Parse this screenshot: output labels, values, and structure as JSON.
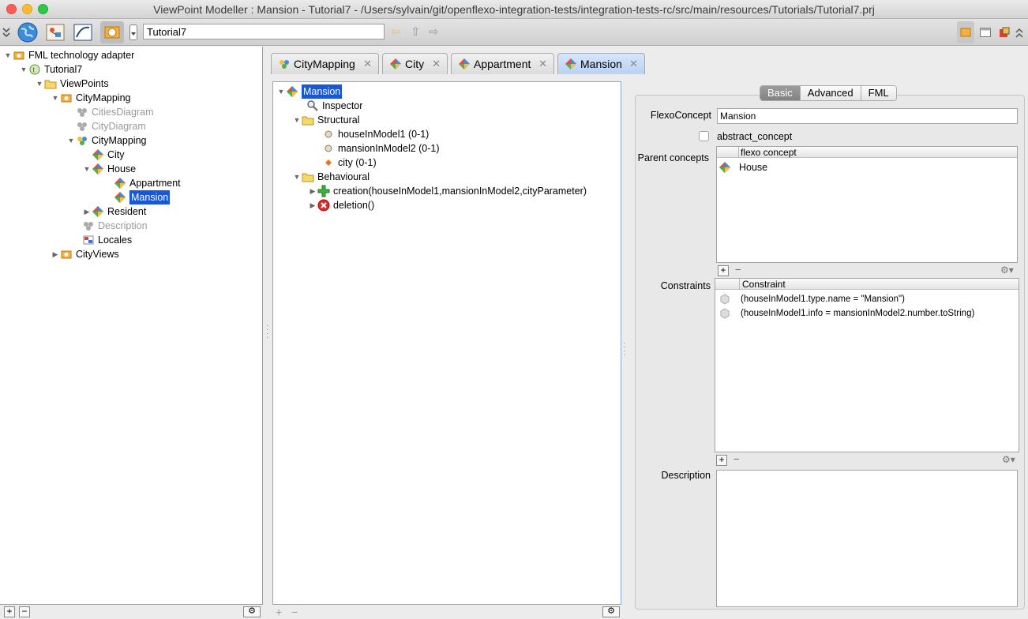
{
  "window": {
    "title": "ViewPoint Modeller : Mansion - Tutorial7 - /Users/sylvain/git/openflexo-integration-tests/integration-tests-rc/src/main/resources/Tutorials/Tutorial7.prj"
  },
  "toolbar": {
    "project_value": "Tutorial7",
    "icons": [
      "double-chevron-icon",
      "globe-icon",
      "diagram-icon",
      "draw-icon",
      "viewpoint-icon",
      "dropdown-icon",
      "back-arrow-icon",
      "up-arrow-icon",
      "forward-arrow-icon",
      "viewpoint-mode-icon",
      "panel-icon",
      "layout-icon",
      "collapse-icon"
    ]
  },
  "left_tree": {
    "items": [
      {
        "label": "FML technology adapter"
      },
      {
        "label": "Tutorial7"
      },
      {
        "label": "ViewPoints"
      },
      {
        "label": "CityMapping"
      },
      {
        "label": "CitiesDiagram"
      },
      {
        "label": "CityDiagram"
      },
      {
        "label": "CityMapping"
      },
      {
        "label": "City"
      },
      {
        "label": "House"
      },
      {
        "label": "Appartment"
      },
      {
        "label": "Mansion"
      },
      {
        "label": "Resident"
      },
      {
        "label": "Description"
      },
      {
        "label": "Locales"
      },
      {
        "label": "CityViews"
      }
    ],
    "add": "+",
    "remove": "−"
  },
  "tabs": [
    {
      "label": "CityMapping"
    },
    {
      "label": "City"
    },
    {
      "label": "Appartment"
    },
    {
      "label": "Mansion"
    }
  ],
  "mid_tree": {
    "items": [
      {
        "label": "Mansion"
      },
      {
        "label": "Inspector"
      },
      {
        "label": "Structural"
      },
      {
        "label": "houseInModel1 (0-1)"
      },
      {
        "label": "mansionInModel2 (0-1)"
      },
      {
        "label": "city (0-1)"
      },
      {
        "label": "Behavioural"
      },
      {
        "label": "creation(houseInModel1,mansionInModel2,cityParameter)"
      },
      {
        "label": "deletion()"
      }
    ],
    "add": "+",
    "remove": "−"
  },
  "inspector": {
    "tabs": [
      "Basic",
      "Advanced",
      "FML"
    ],
    "flexo_concept_label": "FlexoConcept",
    "flexo_concept_value": "Mansion",
    "abstract_label": "abstract_concept",
    "parent_label": "Parent concepts",
    "parent_header": "flexo concept",
    "parent_rows": [
      "House"
    ],
    "constraints_label": "Constraints",
    "constraints_header": "Constraint",
    "constraint_rows": [
      "(houseInModel1.type.name = \"Mansion\")",
      "(houseInModel1.info = mansionInModel2.number.toString)"
    ],
    "description_label": "Description",
    "add": "+",
    "remove": "−"
  },
  "colors": {
    "selection": "#1a57d5",
    "active_tab": "#bad2f5"
  }
}
